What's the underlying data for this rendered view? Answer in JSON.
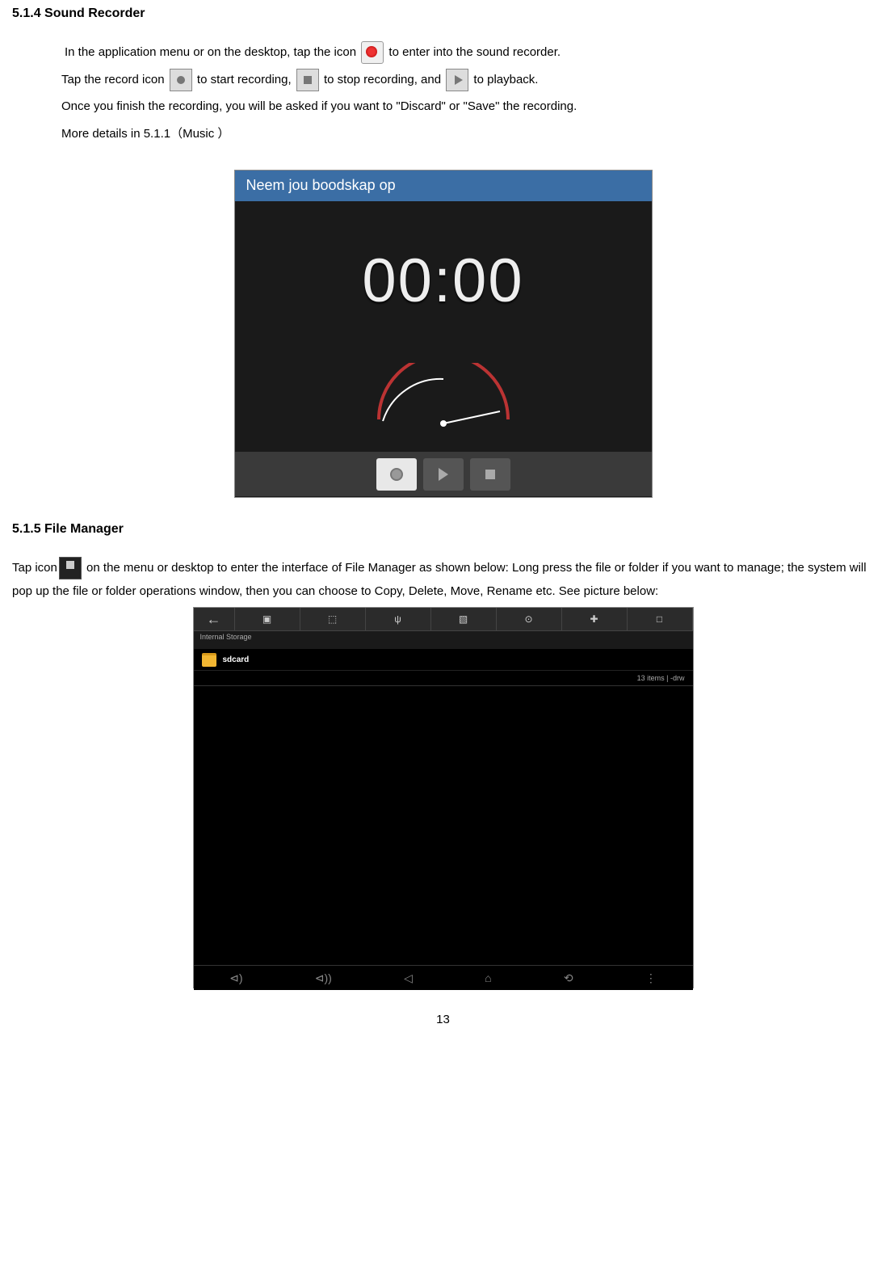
{
  "section1": {
    "heading": "5.1.4 Sound Recorder",
    "text_line1_a": "In the application menu or on the desktop, tap the icon ",
    "text_line1_b": " to enter into the sound recorder.",
    "text_line2_a": "Tap the record icon ",
    "text_line2_b": " to start recording, ",
    "text_line2_c": " to stop recording, and ",
    "text_line2_d": " to playback.",
    "text_line3": "Once you finish the recording, you will be asked if you want to \"Discard\" or \"Save\" the recording.",
    "text_line4": "More details in 5.1.1（Music ）"
  },
  "screenshot1": {
    "header": "Neem jou boodskap op",
    "time": "00:00"
  },
  "section2": {
    "heading": "5.1.5 File Manager",
    "text_a": "Tap icon",
    "text_b": " on the menu or desktop to enter the interface of File Manager as shown below: Long press the file or folder if you want to    manage; the system will pop up the file or folder operations window, then you can choose to Copy, Delete, Move, Rename etc. See picture below:"
  },
  "screenshot2": {
    "path": "Internal Storage",
    "folder_name": "sdcard",
    "folder_meta": "13 items | -drw",
    "back_icon": "←",
    "top_icons": [
      "▣",
      "⬚",
      "ψ",
      "▧",
      "⊙",
      "✚",
      "□"
    ]
  },
  "page_number": "13"
}
